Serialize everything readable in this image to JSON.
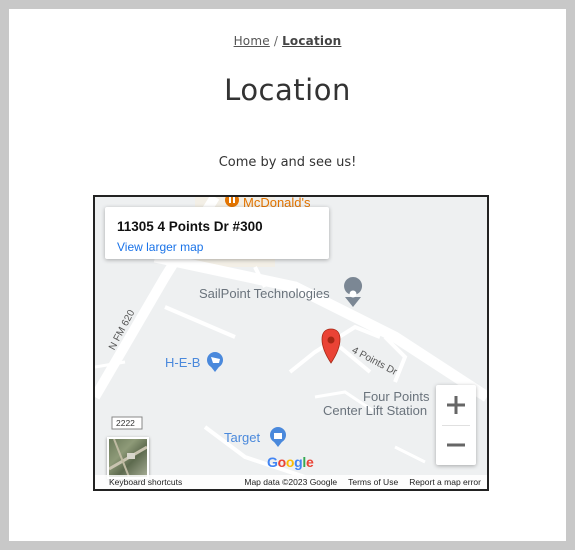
{
  "breadcrumb": {
    "home": "Home",
    "separator": "/",
    "current": "Location"
  },
  "page": {
    "title": "Location",
    "tagline": "Come by and see us!"
  },
  "map": {
    "info_card": {
      "address": "11305 4 Points Dr #300",
      "link": "View larger map"
    },
    "pois": {
      "mcdonalds": "McDonald's",
      "sailpoint": "SailPoint Technologies",
      "heb": "H-E-B",
      "four_points_line1": "Four Points",
      "four_points_line2": "Center Lift Station",
      "target": "Target"
    },
    "roads": {
      "fm620": "N FM 620",
      "four_points_dr": "4 Points Dr",
      "route_2222": "2222"
    },
    "zoom": {
      "in": "+",
      "out": "−"
    },
    "google_logo": [
      "G",
      "o",
      "o",
      "g",
      "l",
      "e"
    ],
    "footer": {
      "shortcuts": "Keyboard shortcuts",
      "map_data": "Map data ©2023 Google",
      "terms": "Terms of Use",
      "report": "Report a map error"
    },
    "colors": {
      "marker": "#ea4335",
      "poi_blue": "#4a89dc",
      "poi_gray": "#7b8794",
      "poi_orange": "#e37400",
      "link": "#1a73e8"
    }
  }
}
